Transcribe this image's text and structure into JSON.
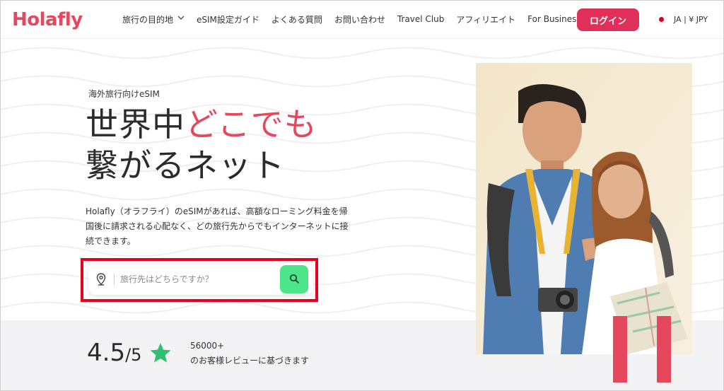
{
  "brand": {
    "logo_text": "Holafly",
    "accent_color": "#e5475d",
    "cta_color": "#e0305a",
    "search_button_color": "#4ce58a",
    "star_color": "#2fbf71"
  },
  "nav": {
    "items": [
      {
        "label": "旅行の目的地",
        "has_dropdown": true
      },
      {
        "label": "eSIM設定ガイド"
      },
      {
        "label": "よくある質問"
      },
      {
        "label": "お問い合わせ"
      },
      {
        "label": "Travel Club"
      },
      {
        "label": "アフィリエイト"
      },
      {
        "label": "For Business"
      }
    ],
    "login_label": "ログイン",
    "locale_label": "JA | ¥ JPY"
  },
  "hero": {
    "eyebrow": "海外旅行向けeSIM",
    "headline_part1": "世界中",
    "headline_accent": "どこでも",
    "headline_line2": "繋がるネット",
    "description": "Holafly（オラフライ）のeSIMがあれば、高額なローミング料金を帰国後に請求される心配なく、どの旅行先からでもインターネットに接続できます。"
  },
  "search": {
    "placeholder": "旅行先はどちらですか？"
  },
  "rating": {
    "score": "4.5",
    "out_of": "/5",
    "review_count": "56000+",
    "review_text": "のお客様レビューに基づきます"
  }
}
